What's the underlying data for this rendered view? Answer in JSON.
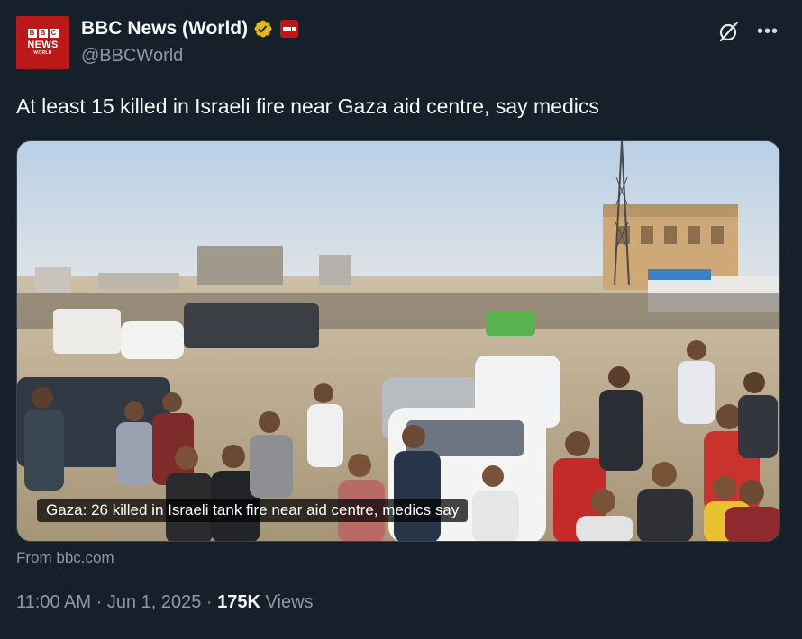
{
  "account": {
    "display_name": "BBC News (World)",
    "handle": "@BBCWorld",
    "avatar": {
      "logo_letters": [
        "B",
        "B",
        "C"
      ],
      "line1": "NEWS",
      "line2": "WORLD"
    }
  },
  "tweet": {
    "text": "At least 15 killed in Israeli fire near Gaza aid centre, say medics"
  },
  "card": {
    "caption": "Gaza: 26 killed in Israeli tank fire near aid centre, medics say",
    "source": "From bbc.com"
  },
  "meta": {
    "time": "11:00 AM",
    "separator": "·",
    "date": "Jun 1, 2025",
    "views_count": "175K",
    "views_label": "Views"
  },
  "icons": [
    "verified-icon",
    "affiliate-badge-icon",
    "grok-icon",
    "more-icon"
  ],
  "colors": {
    "background": "#15202b",
    "bbc_red": "#bb1919",
    "verified_gold": "#e2b719",
    "secondary_text": "#8b98a5"
  }
}
